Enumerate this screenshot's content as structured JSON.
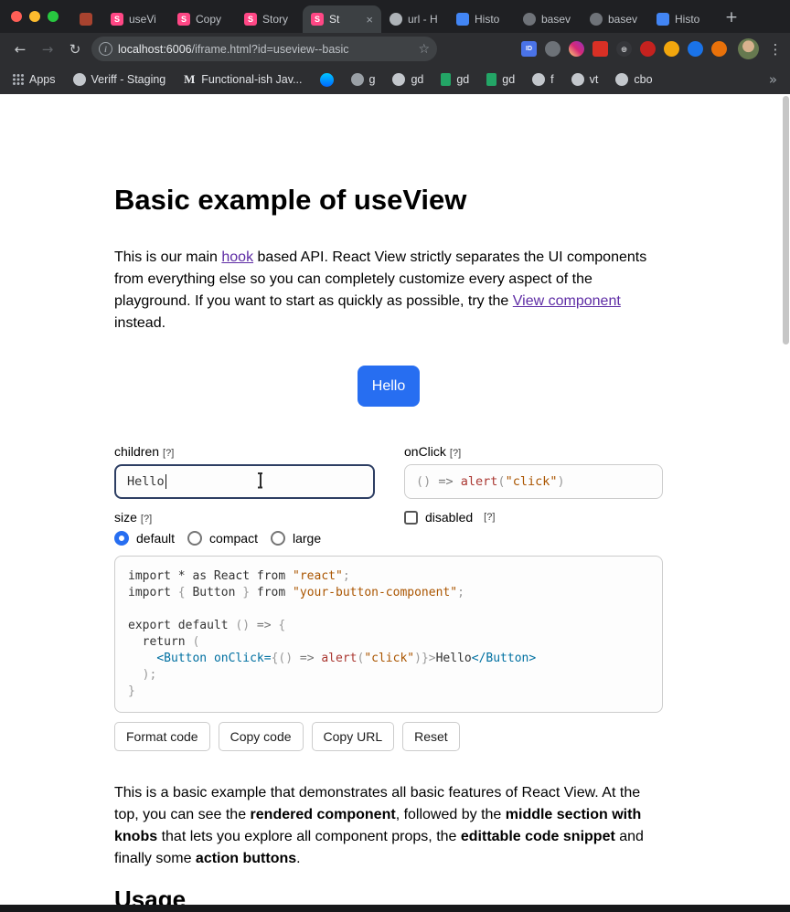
{
  "theme": {
    "accent_blue": "#276ef1",
    "link_purple": "#5e2ca5",
    "focus_border": "#2d3e63",
    "storybook_pink": "#ff4785",
    "code_plain": "#333333",
    "code_punct": "#999999",
    "code_operator": "#777777",
    "code_string": "#aa5500",
    "code_function": "#aa3731",
    "code_tag": "#0070a1",
    "code_attr": "#0070a1"
  },
  "browser": {
    "tabs": [
      {
        "label": "",
        "icon": "site",
        "glyph": "",
        "active": false
      },
      {
        "label": "useVi",
        "icon": "storybook",
        "glyph": "S",
        "active": false
      },
      {
        "label": "Copy",
        "icon": "storybook",
        "glyph": "S",
        "active": false
      },
      {
        "label": "Story",
        "icon": "storybook",
        "glyph": "S",
        "active": false
      },
      {
        "label": "St",
        "icon": "storybook",
        "glyph": "S",
        "active": true
      },
      {
        "label": "url - H",
        "icon": "gray",
        "glyph": "",
        "active": false
      },
      {
        "label": "Histo",
        "icon": "history",
        "glyph": "",
        "active": false
      },
      {
        "label": "basev",
        "icon": "chat",
        "glyph": "",
        "active": false
      },
      {
        "label": "basev",
        "icon": "chat",
        "glyph": "",
        "active": false
      },
      {
        "label": "Histo",
        "icon": "history",
        "glyph": "",
        "active": false
      }
    ],
    "close_label": "×",
    "new_tab_label": "+",
    "nav": {
      "back": "←",
      "forward": "→",
      "reload": "↻"
    },
    "address": {
      "info_glyph": "i",
      "host": "localhost:6006",
      "path": "/iframe.html?id=useview--basic",
      "star_glyph": "☆"
    },
    "extensions": [
      {
        "name": "id-badge-extension",
        "bg": "#4a73e8",
        "fg": "#ffffff",
        "glyph": "ID",
        "shape": "square"
      },
      {
        "name": "eye-extension",
        "bg": "#6d7278",
        "fg": "#e8eaed",
        "glyph": "",
        "shape": "circle"
      },
      {
        "name": "camera-extension",
        "bg": "linear-gradient(45deg,#feda75,#d62976,#962fbf)",
        "fg": "#ffffff",
        "glyph": "",
        "shape": "circle"
      },
      {
        "name": "grid-extension",
        "bg": "#d93025",
        "fg": "#ffffff",
        "glyph": "",
        "shape": "square"
      },
      {
        "name": "target-extension",
        "bg": "#35363a",
        "fg": "#e8eaed",
        "glyph": "◎",
        "shape": "circle"
      },
      {
        "name": "shield-extension",
        "bg": "#c5221f",
        "fg": "#ffffff",
        "glyph": "",
        "shape": "circle"
      },
      {
        "name": "pen-extension",
        "bg": "#f2a60d",
        "fg": "#ffffff",
        "glyph": "",
        "shape": "circle"
      },
      {
        "name": "globe-extension",
        "bg": "#1a73e8",
        "fg": "#ffffff",
        "glyph": "",
        "shape": "circle"
      },
      {
        "name": "camera2-extension",
        "bg": "#e8710a",
        "fg": "#ffffff",
        "glyph": "",
        "shape": "circle"
      }
    ],
    "menu_glyph": "⋮",
    "bookmarks": {
      "items": [
        {
          "label": "Apps",
          "icon": "apps",
          "glyph": ""
        },
        {
          "label": "Veriff - Staging",
          "icon": "github",
          "glyph": ""
        },
        {
          "label": "Functional-ish Jav...",
          "icon": "medium",
          "glyph": "M"
        },
        {
          "label": "",
          "icon": "messenger",
          "glyph": ""
        },
        {
          "label": "g",
          "icon": "gray",
          "glyph": ""
        },
        {
          "label": "gd",
          "icon": "github",
          "glyph": ""
        },
        {
          "label": "gd",
          "icon": "sheets",
          "glyph": ""
        },
        {
          "label": "gd",
          "icon": "sheets",
          "glyph": ""
        },
        {
          "label": "f",
          "icon": "github",
          "glyph": ""
        },
        {
          "label": "vt",
          "icon": "github",
          "glyph": ""
        },
        {
          "label": "cbo",
          "icon": "github",
          "glyph": ""
        }
      ],
      "overflow_glyph": "»"
    }
  },
  "page": {
    "title": "Basic example of useView",
    "intro_segments": [
      {
        "text": "This is our main ",
        "type": "text"
      },
      {
        "text": "hook",
        "type": "link"
      },
      {
        "text": " based API. React View strictly separates the UI components from everything else so you can completely customize every aspect of the playground. If you want to start as quickly as possible, try the ",
        "type": "text"
      },
      {
        "text": "View component",
        "type": "link"
      },
      {
        "text": " instead.",
        "type": "text"
      }
    ],
    "preview_button_label": "Hello",
    "knobs": {
      "children": {
        "label": "children",
        "help": "[?]",
        "value": "Hello"
      },
      "onclick": {
        "label": "onClick",
        "help": "[?]",
        "tokens": [
          {
            "text": "() ",
            "type": "punct"
          },
          {
            "text": "=> ",
            "type": "op"
          },
          {
            "text": "alert",
            "type": "func"
          },
          {
            "text": "(",
            "type": "punct"
          },
          {
            "text": "\"click\"",
            "type": "string"
          },
          {
            "text": ")",
            "type": "punct"
          }
        ]
      },
      "size": {
        "label": "size",
        "help": "[?]",
        "options": [
          {
            "label": "default",
            "selected": true
          },
          {
            "label": "compact",
            "selected": false
          },
          {
            "label": "large",
            "selected": false
          }
        ]
      },
      "disabled": {
        "label": "disabled",
        "help": "[?]",
        "checked": false
      }
    },
    "code": {
      "lines": [
        [
          {
            "text": "import * as React from ",
            "type": "plain"
          },
          {
            "text": "\"react\"",
            "type": "string"
          },
          {
            "text": ";",
            "type": "punct"
          }
        ],
        [
          {
            "text": "import ",
            "type": "plain"
          },
          {
            "text": "{",
            "type": "punct"
          },
          {
            "text": " Button ",
            "type": "plain"
          },
          {
            "text": "}",
            "type": "punct"
          },
          {
            "text": " from ",
            "type": "plain"
          },
          {
            "text": "\"your-button-component\"",
            "type": "string"
          },
          {
            "text": ";",
            "type": "punct"
          }
        ],
        [],
        [
          {
            "text": "export default ",
            "type": "plain"
          },
          {
            "text": "()",
            "type": "punct"
          },
          {
            "text": " => ",
            "type": "op"
          },
          {
            "text": "{",
            "type": "punct"
          }
        ],
        [
          {
            "text": "  return ",
            "type": "plain"
          },
          {
            "text": "(",
            "type": "punct"
          }
        ],
        [
          {
            "text": "    ",
            "type": "plain"
          },
          {
            "text": "<Button",
            "type": "tag"
          },
          {
            "text": " ",
            "type": "plain"
          },
          {
            "text": "onClick=",
            "type": "attr"
          },
          {
            "text": "{()",
            "type": "punct"
          },
          {
            "text": " => ",
            "type": "op"
          },
          {
            "text": "alert",
            "type": "func"
          },
          {
            "text": "(",
            "type": "punct"
          },
          {
            "text": "\"click\"",
            "type": "string"
          },
          {
            "text": ")}>",
            "type": "punct"
          },
          {
            "text": "Hello",
            "type": "plain"
          },
          {
            "text": "</Button>",
            "type": "tag"
          }
        ],
        [
          {
            "text": "  ",
            "type": "plain"
          },
          {
            "text": ");",
            "type": "punct"
          }
        ],
        [
          {
            "text": "}",
            "type": "punct"
          }
        ]
      ]
    },
    "actions": [
      {
        "name": "format-code-button",
        "label": "Format code"
      },
      {
        "name": "copy-code-button",
        "label": "Copy code"
      },
      {
        "name": "copy-url-button",
        "label": "Copy URL"
      },
      {
        "name": "reset-button",
        "label": "Reset"
      }
    ],
    "outro_segments": [
      {
        "text": "This is a basic example that demonstrates all basic features of React View. At the top, you can see the ",
        "type": "text"
      },
      {
        "text": "rendered component",
        "type": "bold"
      },
      {
        "text": ", followed by the ",
        "type": "text"
      },
      {
        "text": "middle section with knobs",
        "type": "bold"
      },
      {
        "text": " that lets you explore all component props, the ",
        "type": "text"
      },
      {
        "text": "edittable code snippet",
        "type": "bold"
      },
      {
        "text": " and finally some ",
        "type": "text"
      },
      {
        "text": "action buttons",
        "type": "bold"
      },
      {
        "text": ".",
        "type": "text"
      }
    ],
    "usage_heading": "Usage"
  }
}
